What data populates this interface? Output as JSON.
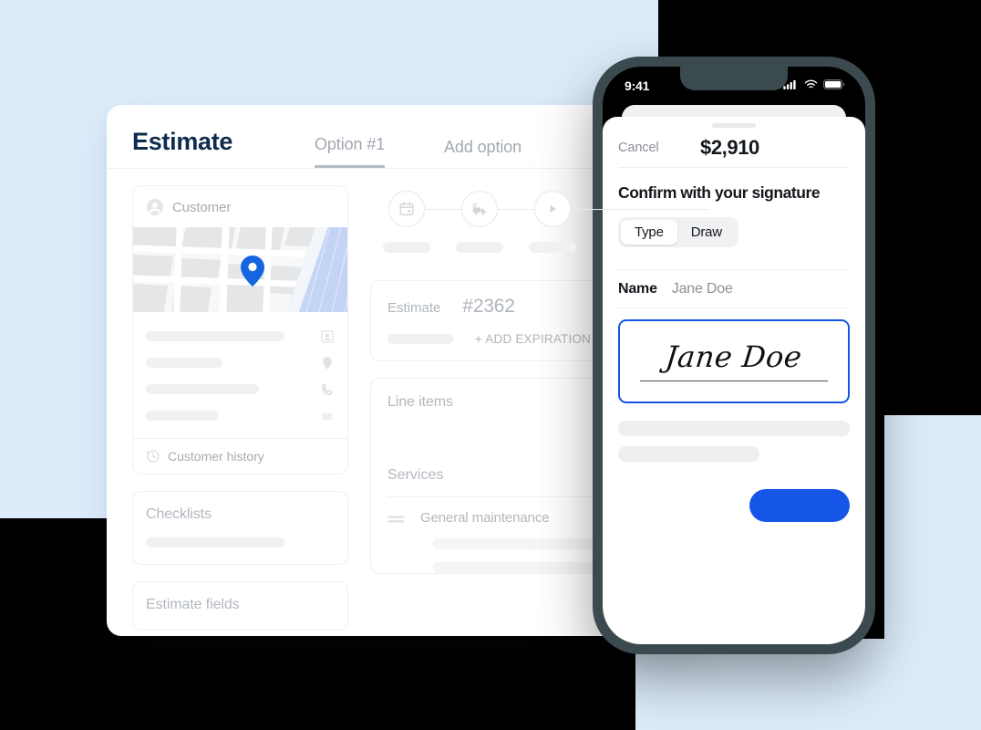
{
  "colors": {
    "background_blue": "#ddecfb",
    "page_black": "#000000",
    "accent_blue": "#1556e8",
    "title_navy": "#0e2c4e",
    "phone_frame": "#3b4a4f",
    "skeleton_gray": "#f0f1f2",
    "muted_text": "#b0b5bb"
  },
  "desktop": {
    "page_title": "Estimate",
    "tabs": [
      {
        "label": "Option #1",
        "active": true
      },
      {
        "label": "Add option",
        "active": false
      }
    ],
    "customer_panel": {
      "header_label": "Customer",
      "header_icon": "customer-avatar-icon",
      "map_pin_icon": "map-pin-icon",
      "detail_rows": [
        {
          "icon": "contact-card-icon"
        },
        {
          "icon": "location-pin-icon"
        },
        {
          "icon": "phone-icon"
        },
        {
          "icon": "message-icon"
        }
      ],
      "footer_label": "Customer history",
      "footer_icon": "history-clock-icon"
    },
    "checklists_panel": {
      "title": "Checklists"
    },
    "estimate_fields_panel": {
      "title": "Estimate fields"
    },
    "workflow": {
      "steps": [
        {
          "icon": "calendar-icon"
        },
        {
          "icon": "truck-icon"
        },
        {
          "icon": "play-icon"
        }
      ]
    },
    "estimate_panel": {
      "label": "Estimate",
      "number": "#2362",
      "add_expiration_label": "+ ADD EXPIRATION DATE"
    },
    "line_items_panel": {
      "title": "Line items",
      "services_title": "Services",
      "service_row": {
        "drag_icon": "drag-handle-icon",
        "name": "General maintenance"
      }
    }
  },
  "phone": {
    "status_bar": {
      "time": "9:41",
      "icons": [
        "cellular-signal-icon",
        "wifi-icon",
        "battery-icon"
      ]
    },
    "sheet": {
      "cancel_label": "Cancel",
      "amount": "$2,910",
      "heading": "Confirm with your signature",
      "segmented_control": {
        "options": [
          {
            "label": "Type",
            "active": true
          },
          {
            "label": "Draw",
            "active": false
          }
        ]
      },
      "name_field": {
        "label": "Name",
        "value": "Jane Doe"
      },
      "signature": {
        "value": "Jane Doe"
      },
      "submit_button": {
        "label": ""
      }
    }
  }
}
